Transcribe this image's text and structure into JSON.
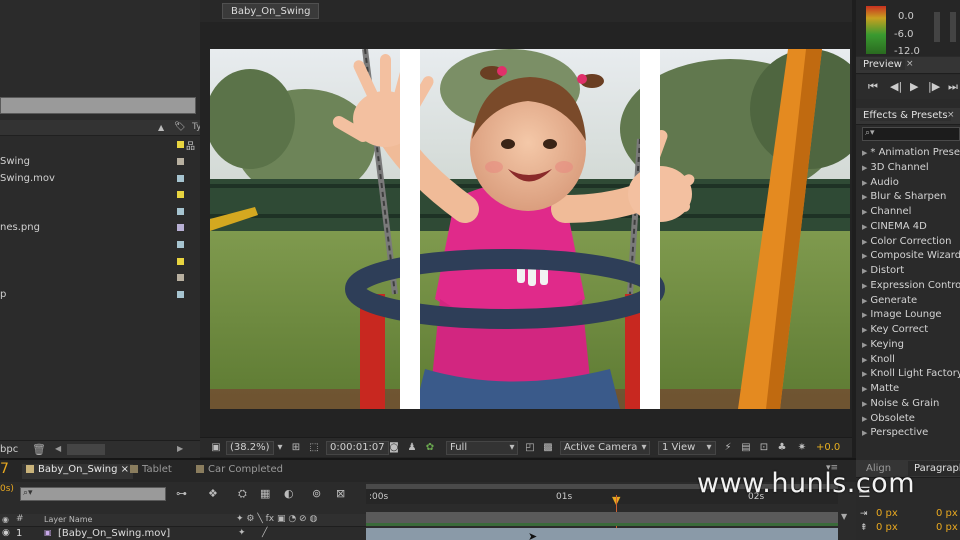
{
  "project_panel": {
    "items": [
      {
        "label": "Swing",
        "color": "#b8b0a0"
      },
      {
        "label": "Swing.mov",
        "color": "#a6c4d0"
      },
      {
        "label": "",
        "color": "#e8d440"
      },
      {
        "label": "",
        "color": "#a6c4d0"
      },
      {
        "label": "nes.png",
        "color": "#b8b0d4"
      },
      {
        "label": "",
        "color": "#a6c4d0"
      },
      {
        "label": "",
        "color": "#e8d440"
      },
      {
        "label": "",
        "color": "#b8b0a0"
      },
      {
        "label": "p",
        "color": "#a6c4d0"
      }
    ],
    "header_first_color": "#e8d440",
    "column_type": "Ty",
    "bpc_label": "bpc"
  },
  "viewer": {
    "tab_label": "Baby_On_Swing",
    "zoom": "(38.2%)",
    "timecode": "0:00:01:07",
    "resolution": "Full",
    "camera": "Active Camera",
    "views": "1 View",
    "exposure": "+0.0"
  },
  "audio_panel": {
    "level_top": "0.0",
    "level_mid": "-6.0",
    "level_bottom": "-12.0"
  },
  "preview_panel": {
    "title": "Preview"
  },
  "effects_panel": {
    "title": "Effects & Presets",
    "search_placeholder": "",
    "categories": [
      "* Animation Presets",
      "3D Channel",
      "Audio",
      "Blur & Sharpen",
      "Channel",
      "CINEMA 4D",
      "Color Correction",
      "Composite Wizard",
      "Distort",
      "Expression Controls",
      "Generate",
      "Image Lounge",
      "Key Correct",
      "Keying",
      "Knoll",
      "Knoll Light Factory",
      "Matte",
      "Noise & Grain",
      "Obsolete",
      "Perspective"
    ]
  },
  "bottom_right": {
    "align_tab": "Align",
    "paragraph_tab": "Paragraph",
    "indent_left": "0 px",
    "indent_right": "0 px",
    "space_before": "0 px",
    "space_after": "0 px"
  },
  "timeline": {
    "current_time": "7",
    "fps_label": "0s)",
    "tabs": [
      {
        "label": "Baby_On_Swing",
        "color": "#c9b37a",
        "active": true
      },
      {
        "label": "Tablet",
        "color": "#8a7d5e",
        "active": false
      },
      {
        "label": "Car Completed",
        "color": "#8a7d5e",
        "active": false
      }
    ],
    "ruler": {
      "start": ":00s",
      "mark1": "01s",
      "mark2": "02s"
    },
    "column_num": "#",
    "column_layer": "Layer Name",
    "layer": {
      "index": "1",
      "name": "[Baby_On_Swing.mov]"
    }
  },
  "watermark": "www.hunls.com",
  "colors": {
    "accent_orange": "#f0a020",
    "playhead": "#d06030"
  }
}
